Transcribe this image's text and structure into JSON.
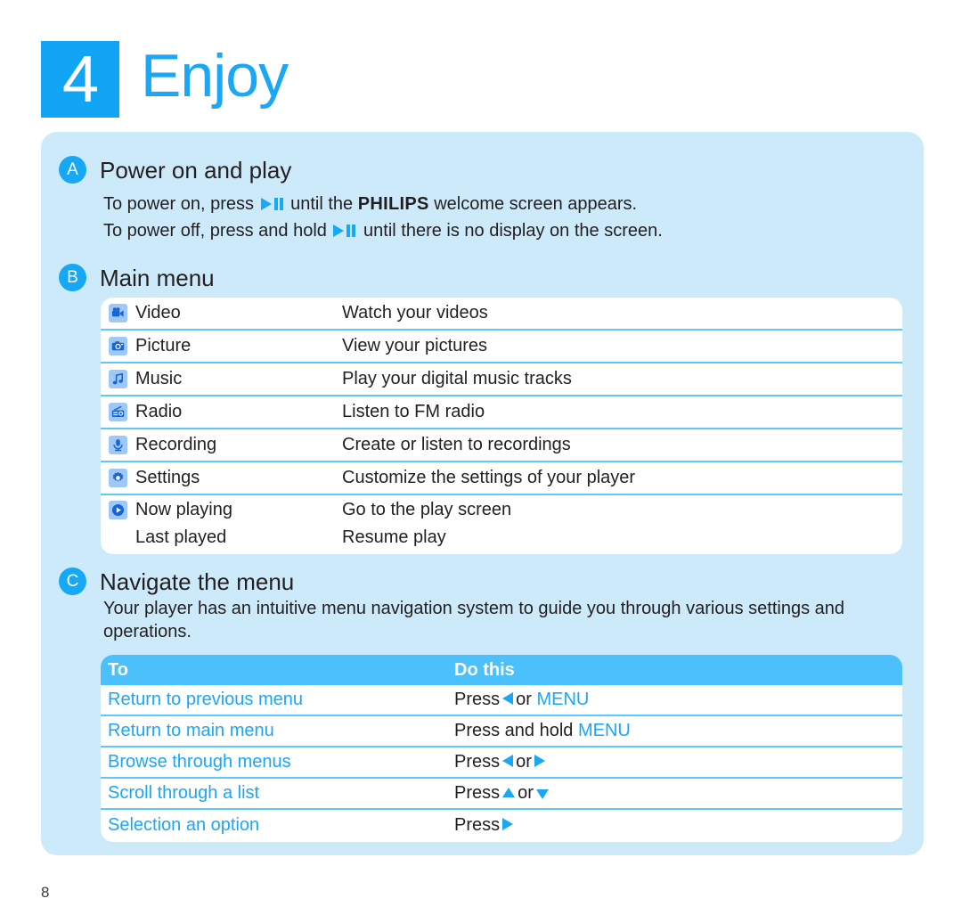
{
  "chapter": {
    "number": "4",
    "title": "Enjoy"
  },
  "sections": {
    "a": {
      "badge": "A",
      "title": "Power on and play",
      "line1_pre": "To power on, press",
      "line1_post": "until the",
      "line1_brand": "PHILIPS",
      "line1_tail": "welcome screen appears.",
      "line2_pre": "To power off, press and hold",
      "line2_post": "until there is no display on the screen."
    },
    "b": {
      "badge": "B",
      "title": "Main menu",
      "items": [
        {
          "icon": "video-camera-icon",
          "label": "Video",
          "desc": "Watch your videos"
        },
        {
          "icon": "camera-icon",
          "label": "Picture",
          "desc": "View your pictures"
        },
        {
          "icon": "music-note-icon",
          "label": "Music",
          "desc": "Play your digital music tracks"
        },
        {
          "icon": "radio-icon",
          "label": "Radio",
          "desc": "Listen to FM radio"
        },
        {
          "icon": "microphone-icon",
          "label": "Recording",
          "desc": "Create or listen to recordings"
        },
        {
          "icon": "gear-icon",
          "label": "Settings",
          "desc": "Customize the settings of your player"
        },
        {
          "icon": "play-circle-icon",
          "label": "Now playing",
          "desc": "Go to the play screen"
        },
        {
          "icon": "none",
          "label": "Last played",
          "desc": "Resume play"
        }
      ]
    },
    "c": {
      "badge": "C",
      "title": "Navigate the menu",
      "paragraph": "Your player has an intuitive menu navigation system to guide you through various settings and operations.",
      "table": {
        "header": {
          "to": "To",
          "do": "Do this"
        },
        "rows": [
          {
            "to": "Return to previous menu",
            "do_pre": "Press",
            "arrow1": "left",
            "do_mid": "or",
            "keyword": "MENU",
            "arrow2": ""
          },
          {
            "to": "Return to main menu",
            "do_pre": "Press and hold",
            "arrow1": "",
            "do_mid": "",
            "keyword": "MENU",
            "arrow2": ""
          },
          {
            "to": "Browse through menus",
            "do_pre": "Press",
            "arrow1": "left",
            "do_mid": "or",
            "keyword": "",
            "arrow2": "right"
          },
          {
            "to": "Scroll through a list",
            "do_pre": "Press",
            "arrow1": "up",
            "do_mid": "or",
            "keyword": "",
            "arrow2": "down"
          },
          {
            "to": "Selection an option",
            "do_pre": "Press",
            "arrow1": "right",
            "do_mid": "",
            "keyword": "",
            "arrow2": ""
          }
        ]
      }
    }
  },
  "footer": {
    "page_number": "8"
  },
  "colors": {
    "accent_blue": "#1ba7f5",
    "panel_blue": "#cdeafa",
    "header_bar_blue": "#4cc0fb",
    "rule_blue": "#5ec8fb",
    "icon_tile": "#9fc8f4"
  }
}
